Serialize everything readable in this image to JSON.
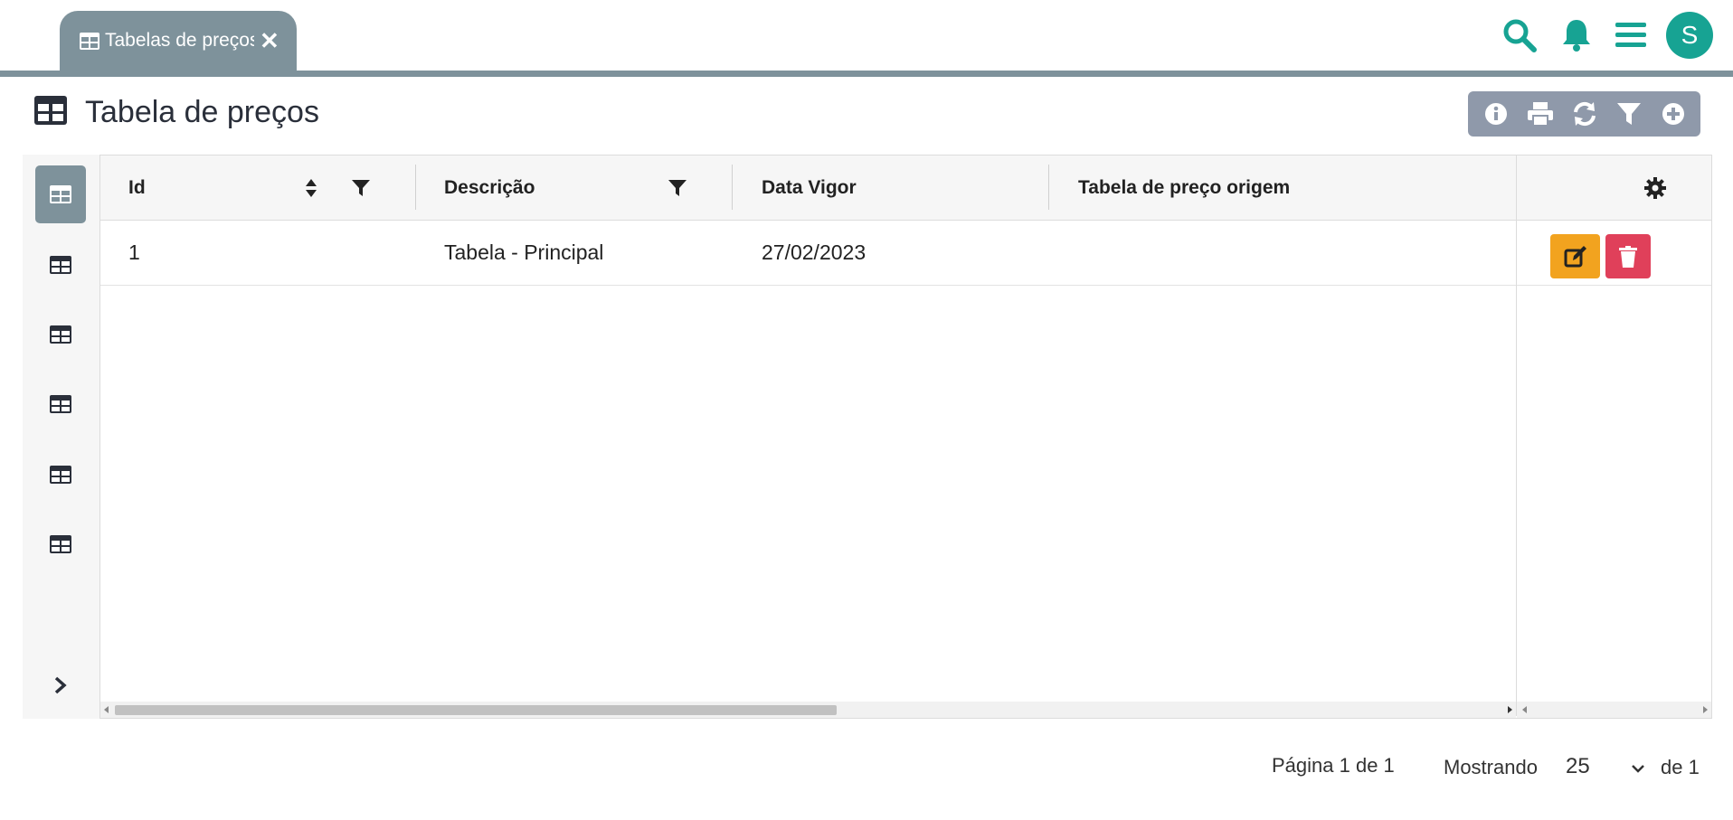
{
  "tab": {
    "label": "Tabelas de preços"
  },
  "user": {
    "avatar_letter": "S"
  },
  "page": {
    "title": "Tabela de preços"
  },
  "table": {
    "columns": [
      "Id",
      "Descrição",
      "Data Vigor",
      "Tabela de preço origem"
    ],
    "rows": [
      {
        "id": "1",
        "descricao": "Tabela - Principal",
        "data_vigor": "27/02/2023",
        "origem": ""
      }
    ]
  },
  "pagination": {
    "page_label": "Página 1 de 1",
    "showing_label": "Mostrando",
    "page_size": "25",
    "of_label": "de 1"
  },
  "colors": {
    "accent": "#17a393",
    "tab_bg": "#7e929b",
    "toolbar_bg": "#8f99aa",
    "edit": "#f2a31f",
    "delete": "#e0405a"
  }
}
